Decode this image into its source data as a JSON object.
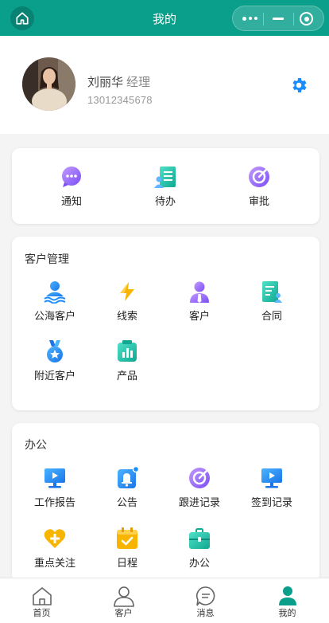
{
  "header": {
    "title": "我的"
  },
  "profile": {
    "name": "刘丽华",
    "role": "经理",
    "phone": "13012345678"
  },
  "quick": {
    "items": [
      {
        "label": "通知",
        "icon": "message-bubble-icon"
      },
      {
        "label": "待办",
        "icon": "task-list-icon"
      },
      {
        "label": "审批",
        "icon": "approval-icon"
      }
    ]
  },
  "customer": {
    "title": "客户管理",
    "items": [
      {
        "label": "公海客户",
        "icon": "sea-customer-icon"
      },
      {
        "label": "线索",
        "icon": "lightning-icon"
      },
      {
        "label": "客户",
        "icon": "customer-icon"
      },
      {
        "label": "合同",
        "icon": "contract-icon"
      },
      {
        "label": "附近客户",
        "icon": "medal-icon"
      },
      {
        "label": "产品",
        "icon": "product-chart-icon"
      }
    ]
  },
  "office": {
    "title": "办公",
    "items": [
      {
        "label": "工作报告",
        "icon": "monitor-icon"
      },
      {
        "label": "公告",
        "icon": "bell-icon"
      },
      {
        "label": "跟进记录",
        "icon": "follow-up-icon"
      },
      {
        "label": "签到记录",
        "icon": "monitor-icon"
      },
      {
        "label": "重点关注",
        "icon": "heart-plus-icon"
      },
      {
        "label": "日程",
        "icon": "calendar-icon"
      },
      {
        "label": "办公",
        "icon": "briefcase-icon"
      }
    ]
  },
  "tabs": [
    {
      "label": "首页",
      "icon": "home-icon"
    },
    {
      "label": "客户",
      "icon": "user-icon"
    },
    {
      "label": "消息",
      "icon": "chat-icon"
    },
    {
      "label": "我的",
      "icon": "profile-icon"
    }
  ],
  "colors": {
    "primary": "#0a9f8b",
    "accent_blue": "#1a8cff",
    "accent_purple": "#8b5cf6"
  }
}
